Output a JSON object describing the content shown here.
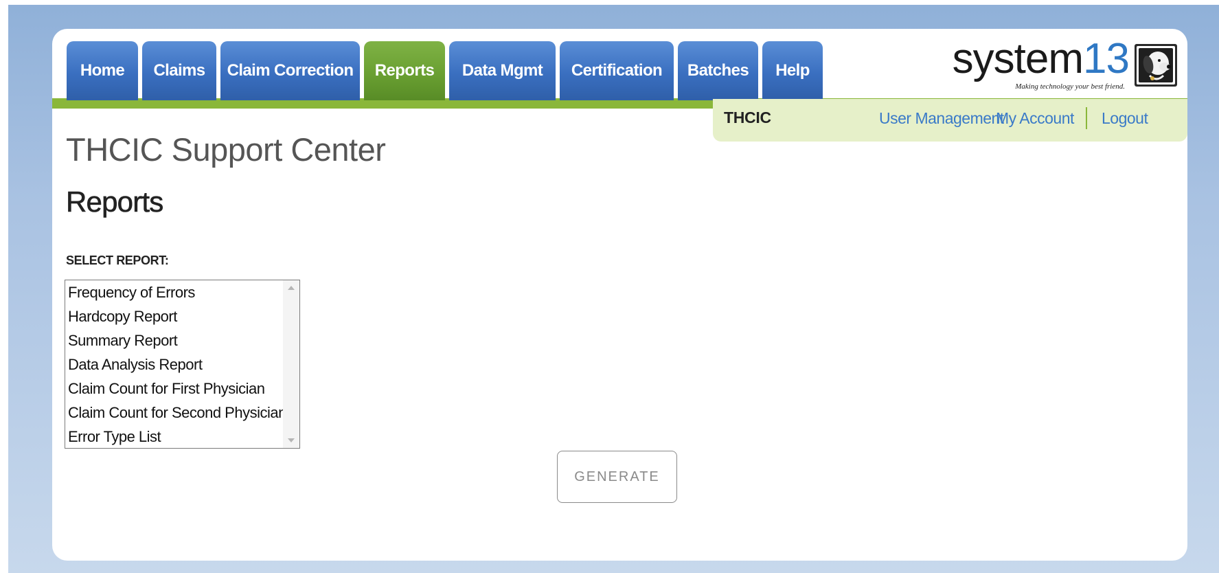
{
  "nav": {
    "tabs": [
      {
        "label": "Home",
        "active": false
      },
      {
        "label": "Claims",
        "active": false
      },
      {
        "label": "Claim Correction",
        "active": false
      },
      {
        "label": "Reports",
        "active": true
      },
      {
        "label": "Data Mgmt",
        "active": false
      },
      {
        "label": "Certification",
        "active": false
      },
      {
        "label": "Batches",
        "active": false
      },
      {
        "label": "Help",
        "active": false
      }
    ]
  },
  "brand": {
    "word": "system",
    "number": "13",
    "tagline": "Making technology your best friend.",
    "icon": "dog-icon"
  },
  "subbar": {
    "org": "THCIC",
    "links": {
      "user_management": "User Management",
      "my_account": "My Account",
      "logout": "Logout"
    }
  },
  "main": {
    "site_title": "THCIC Support Center",
    "heading": "Reports",
    "select_label": "SELECT REPORT:",
    "reports": [
      "Frequency of Errors",
      "Hardcopy Report",
      "Summary Report",
      "Data Analysis Report",
      "Claim Count for First Physician",
      "Claim Count for Second Physician",
      "Error Type List"
    ],
    "generate_label": "GENERATE"
  },
  "colors": {
    "tab_blue": "#3a6fc0",
    "tab_active_green": "#6aa032",
    "accent_green": "#8ab73a",
    "subbar_bg": "#e6f0c9",
    "link_blue": "#3a7ac8",
    "logo_number_blue": "#2f78c4"
  }
}
